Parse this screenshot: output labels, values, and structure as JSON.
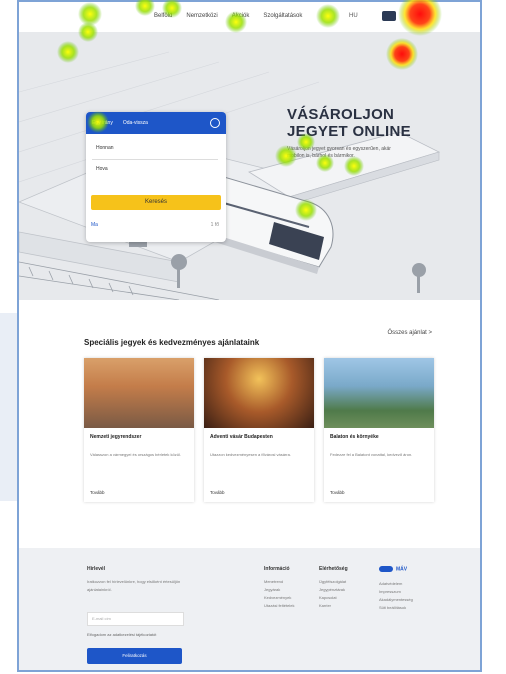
{
  "nav": {
    "links": [
      "Belföld",
      "Nemzetközi",
      "Akciók",
      "Szolgáltatások"
    ],
    "language": "HU"
  },
  "hero": {
    "title_line1": "VÁSÁROLJON",
    "title_line2": "JEGYET ONLINE",
    "subtitle": "Vásároljon jegyet gyorsan és egyszerűen, akár mobilon is, bárhol és bármikor."
  },
  "search": {
    "tab_one_way": "Egy irány",
    "tab_return": "Oda-vissza",
    "from_placeholder": "Honnan",
    "to_placeholder": "Hova",
    "submit_label": "Keresés",
    "date_label": "Ma",
    "passengers_label": "1 fő"
  },
  "offers": {
    "section_title": "Speciális jegyek és kedvezményes ajánlataink",
    "see_all": "Összes ajánlat >",
    "cards": [
      {
        "title": "Nemzeti jegyrendszer",
        "desc": "Válasszon a vármegyei és országos bérletek közül.",
        "button": "Tovább"
      },
      {
        "title": "Adventi vásár Budapesten",
        "desc": "Utazzon kedvezményesen a fővárosi vásárra.",
        "button": "Tovább"
      },
      {
        "title": "Balaton és környéke",
        "desc": "Fedezze fel a Balatont vonattal, kedvező áron.",
        "button": "Tovább"
      }
    ]
  },
  "footer": {
    "newsletter_title": "Hírlevél",
    "newsletter_text": "Iratkozzon fel hírlevelünkre, hogy elsőként értesüljön ajánlatainkról.",
    "email_placeholder": "E-mail cím",
    "consent_text": "Elfogadom az adatkezelési tájékoztatót",
    "subscribe_label": "Feliratkozás",
    "col1_title": "Információ",
    "col1_links": [
      "Menetrend",
      "Jegyárak",
      "Kedvezmények",
      "Utazási feltételek"
    ],
    "col2_title": "Elérhetőség",
    "col2_links": [
      "Ügyfélszolgálat",
      "Jegypénztárak",
      "Kapcsolat",
      "Karrier"
    ],
    "brand": "MÁV",
    "brand_links": [
      "Adatvédelem",
      "Impresszum",
      "Akadálymentesség",
      "Süti beállítások"
    ]
  },
  "colors": {
    "brand_blue": "#1e56c8",
    "cta_yellow": "#f6c21a",
    "frame_border": "#7ea3d6"
  }
}
